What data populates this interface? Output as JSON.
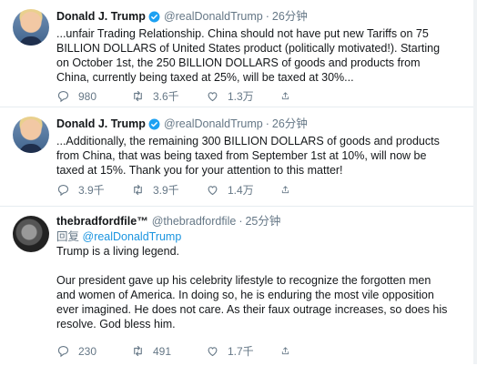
{
  "colors": {
    "accent": "#1b95e0",
    "muted": "#657786",
    "divider": "#e6ecf0"
  },
  "tweets": [
    {
      "author_name": "Donald J. Trump",
      "verified": true,
      "handle": "@realDonaldTrump",
      "separator": "·",
      "time": "26分钟",
      "text_lines": [
        "...unfair Trading Relationship. China should not have put new Tariffs on 75",
        "BILLION DOLLARS of United States product (politically motivated!). Starting",
        "on October 1st, the 250 BILLION DOLLARS of goods and products from",
        "China, currently being taxed at 25%, will be taxed at 30%..."
      ],
      "replies": "980",
      "retweets": "3.6千",
      "likes": "1.3万"
    },
    {
      "author_name": "Donald J. Trump",
      "verified": true,
      "handle": "@realDonaldTrump",
      "separator": "·",
      "time": "26分钟",
      "text_lines": [
        "...Additionally, the remaining 300 BILLION DOLLARS of goods and products",
        "from China, that was being taxed from September 1st at 10%, will now be",
        "taxed at 15%. Thank you for your attention to this matter!"
      ],
      "replies": "3.9千",
      "retweets": "3.9千",
      "likes": "1.4万"
    },
    {
      "author_name": "thebradfordfile™",
      "verified": false,
      "handle": "@thebradfordfile",
      "separator": "·",
      "time": "25分钟",
      "reply_prefix": "回复",
      "reply_to": "@realDonaldTrump",
      "para1": "Trump is a living legend.",
      "para2_lines": [
        "Our president gave up his celebrity lifestyle to recognize the forgotten men",
        "and women of America. In doing so, he is enduring the most vile opposition",
        "ever imagined. He does not care. As their faux outrage increases, so does his",
        "resolve. God bless him."
      ],
      "replies": "230",
      "retweets": "491",
      "likes": "1.7千"
    }
  ]
}
